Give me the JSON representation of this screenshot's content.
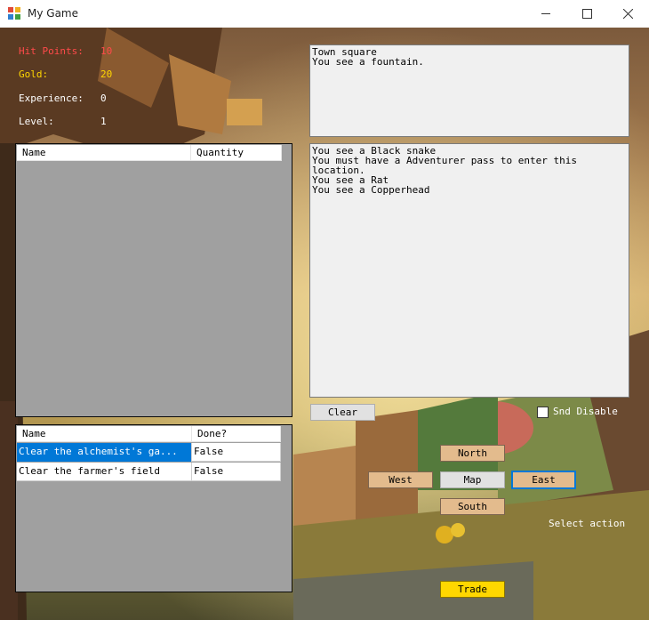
{
  "window": {
    "title": "My Game",
    "icon": "game-app-icon"
  },
  "stats": {
    "hit_points_label": "Hit Points:",
    "hit_points_value": "10",
    "gold_label": "Gold:",
    "gold_value": "20",
    "experience_label": "Experience:",
    "experience_value": "0",
    "level_label": "Level:",
    "level_value": "1"
  },
  "inventory": {
    "columns": [
      "Name",
      "Quantity"
    ],
    "rows": []
  },
  "quests": {
    "columns": [
      "Name",
      "Done?"
    ],
    "rows": [
      [
        "Clear the alchemist's ga...",
        "False"
      ],
      [
        "Clear the farmer's field",
        "False"
      ]
    ]
  },
  "location_text": "Town square\nYou see a fountain.",
  "messages_text": "You see a Black snake\nYou must have a Adventurer pass to enter this\nlocation.\nYou see a Rat\nYou see a Copperhead",
  "buttons": {
    "clear": "Clear",
    "north": "North",
    "west": "West",
    "map": "Map",
    "east": "East",
    "south": "South",
    "trade": "Trade"
  },
  "sound_toggle": {
    "label": "Snd Disable",
    "checked": false
  },
  "action_label": "Select action",
  "colors": {
    "hit_points": "#ff4a4a",
    "gold": "#ffd700",
    "direction_button": "#e3bb8d",
    "trade_button": "#ffd700",
    "selection": "#0078d7"
  }
}
